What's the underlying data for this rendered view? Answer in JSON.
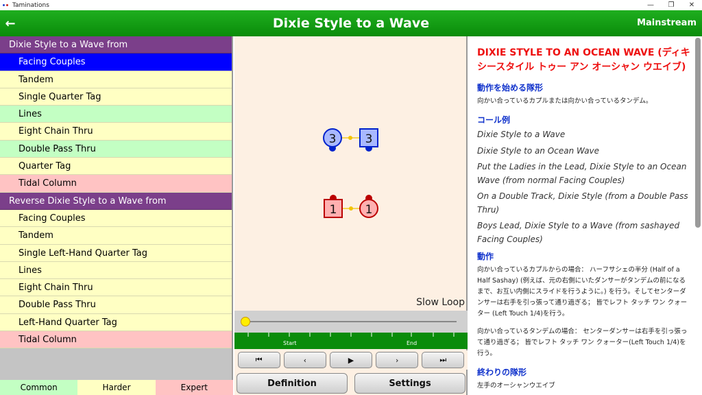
{
  "window": {
    "title": "Taminations"
  },
  "header": {
    "title": "Dixie Style to a Wave",
    "level": "Mainstream"
  },
  "left_list": [
    {
      "label": "Dixie Style to a Wave from",
      "kind": "head"
    },
    {
      "label": "Facing Couples",
      "kind": "selected"
    },
    {
      "label": "Tandem",
      "kind": "common"
    },
    {
      "label": "Single Quarter Tag",
      "kind": "common"
    },
    {
      "label": "Lines",
      "kind": "harder"
    },
    {
      "label": "Eight Chain Thru",
      "kind": "common"
    },
    {
      "label": "Double Pass Thru",
      "kind": "harder"
    },
    {
      "label": "Quarter Tag",
      "kind": "common"
    },
    {
      "label": "Tidal Column",
      "kind": "expert"
    },
    {
      "label": "Reverse Dixie Style to a Wave from",
      "kind": "head"
    },
    {
      "label": "Facing Couples",
      "kind": "common"
    },
    {
      "label": "Tandem",
      "kind": "common"
    },
    {
      "label": "Single Left-Hand Quarter Tag",
      "kind": "common"
    },
    {
      "label": "Lines",
      "kind": "common"
    },
    {
      "label": "Eight Chain Thru",
      "kind": "common"
    },
    {
      "label": "Double Pass Thru",
      "kind": "common"
    },
    {
      "label": "Left-Hand Quarter Tag",
      "kind": "common"
    },
    {
      "label": "Tidal Column",
      "kind": "expert"
    }
  ],
  "legend": {
    "common": "Common",
    "harder": "Harder",
    "expert": "Expert"
  },
  "animation": {
    "dancers": [
      {
        "number": "3",
        "shape": "circle",
        "color": "#3344ee"
      },
      {
        "number": "3",
        "shape": "square",
        "color": "#3344ee"
      },
      {
        "number": "1",
        "shape": "square",
        "color": "#cc1111"
      },
      {
        "number": "1",
        "shape": "circle",
        "color": "#cc1111"
      }
    ],
    "slow_loop": "Slow Loop",
    "tick_start": "Start",
    "tick_end": "End",
    "slider_position": 0
  },
  "controls": {
    "first": "⏮",
    "prev": "‹",
    "play": "▶",
    "next": "›",
    "last": "⏭",
    "definition": "Definition",
    "settings": "Settings"
  },
  "definition": {
    "title": "DIXIE STYLE TO AN OCEAN WAVE (ディキシースタイル トゥー アン オーシャン ウエイブ)",
    "start_heading": "動作を始める隊形",
    "start_text": "向かい合っているカプルまたは向かい合っているタンデム。",
    "examples_heading": "コール例",
    "examples": [
      "Dixie Style to a Wave",
      "Dixie Style to an Ocean Wave",
      "Put the Ladies in the Lead, Dixie Style to an Ocean Wave (from normal Facing Couples)",
      "On a Double Track, Dixie Style (from a Double Pass Thru)",
      "Boys Lead, Dixie Style to a Wave (from sashayed Facing Couples)"
    ],
    "action_heading": "動作",
    "action_text_1": "向かい合っているカプルからの場合： ハーフサシェの半分 (Half of a Half Sashay) (例えば、元の右側にいたダンサーがタンデムの前になるまで、お互い内側にスライドを行うように。) を行う。そしてセンターダンサーは右手を引っ張って通り過ぎる； 皆でレフト タッチ ワン クォーター (Left Touch 1/4)を行う。",
    "action_text_2": "向かい合っているタンデムの場合： センターダンサーは右手を引っ張って通り過ぎる； 皆でレフト タッチ ワン クォーター(Left Touch 1/4)を行う。",
    "end_heading": "終わりの隊形",
    "end_text": "左手のオーシャンウエイブ"
  }
}
